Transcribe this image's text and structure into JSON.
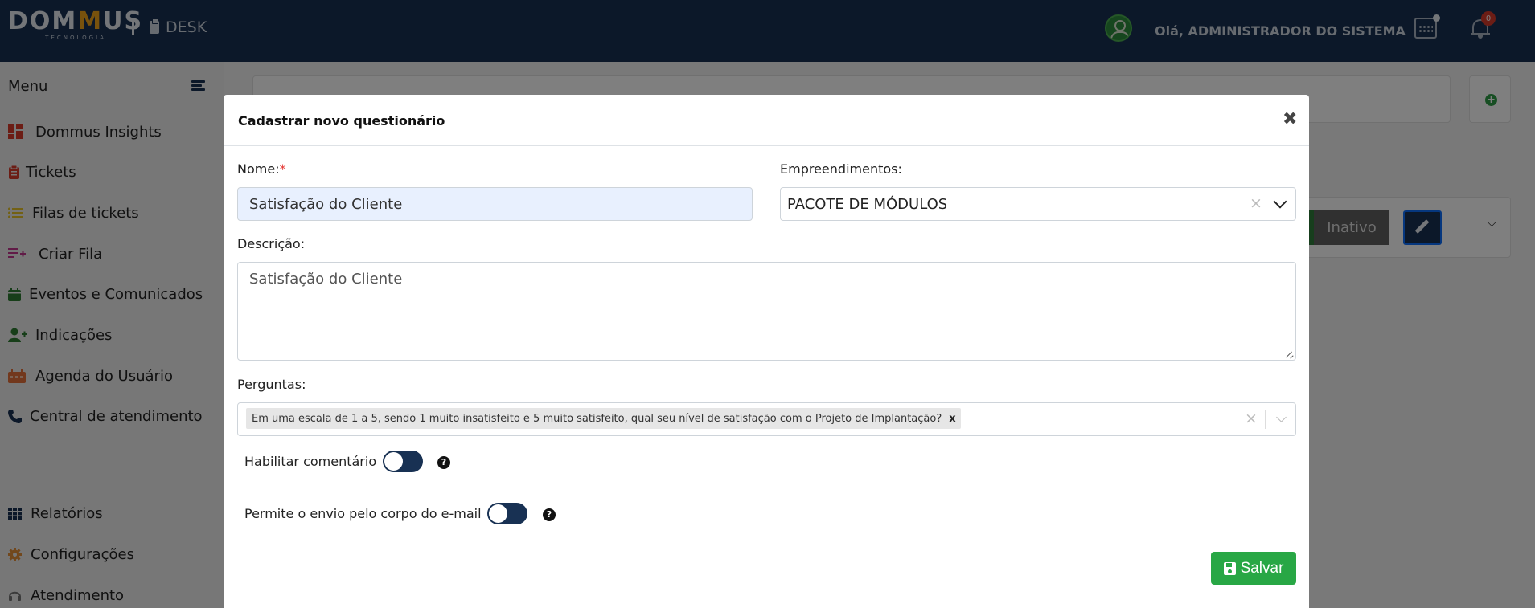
{
  "header": {
    "brand": {
      "part1": "DOM",
      "part2": "M",
      "part3": "US",
      "tagline": "TECNOLOGIA"
    },
    "module_label": "DESK",
    "greeting": "Olá, ADMINISTRADOR DO SISTEMA",
    "notification_count": "0"
  },
  "sidebar": {
    "title": "Menu",
    "items": [
      {
        "label": "Dommus Insights",
        "icon": "dashboard-icon",
        "color": "#d93b2b"
      },
      {
        "label": "Tickets",
        "icon": "clipboard-icon",
        "color": "#d93b2b"
      },
      {
        "label": "Filas de tickets",
        "icon": "list-icon",
        "color": "#e6c229"
      },
      {
        "label": "Criar Fila",
        "icon": "list-add-icon",
        "color": "#c2378f"
      },
      {
        "label": "Eventos e Comunicados",
        "icon": "calendar-icon",
        "color": "#2e7d32"
      },
      {
        "label": "Indicações",
        "icon": "user-plus-icon",
        "color": "#2e7d32"
      },
      {
        "label": "Agenda do Usuário",
        "icon": "calendar-week-icon",
        "color": "#e4703a"
      },
      {
        "label": "Central de atendimento",
        "icon": "phone-icon",
        "color": "#183153"
      }
    ],
    "bottom_items": [
      {
        "label": "Relatórios",
        "icon": "grid-icon",
        "color": "#183153"
      },
      {
        "label": "Configurações",
        "icon": "gear-icon",
        "color": "#e4903a"
      },
      {
        "label": "Atendimento",
        "icon": "headset-icon",
        "color": "#777777"
      }
    ]
  },
  "background": {
    "status_label": "Inativo"
  },
  "modal": {
    "title": "Cadastrar novo questionário",
    "name_label": "Nome:",
    "required_mark": "*",
    "name_value": "Satisfação do Cliente",
    "empreendimentos_label": "Empreendimentos:",
    "empreendimentos_value": "PACOTE DE MÓDULOS",
    "descricao_label": "Descrição:",
    "descricao_value": "Satisfação do Cliente",
    "perguntas_label": "Perguntas:",
    "perguntas_selected": [
      "Em uma escala de 1 a 5, sendo 1 muito insatisfeito e 5 muito satisfeito, qual seu nível de satisfação com o Projeto de Implantação?"
    ],
    "habilitar_comentario_label": "Habilitar comentário",
    "habilitar_comentario_on": false,
    "permite_envio_label": "Permite o envio pelo corpo do e-mail",
    "permite_envio_on": false,
    "help_glyph": "?",
    "save_label": "Salvar",
    "chip_remove": "x",
    "clear_glyph": "×",
    "close_glyph": "✖"
  }
}
